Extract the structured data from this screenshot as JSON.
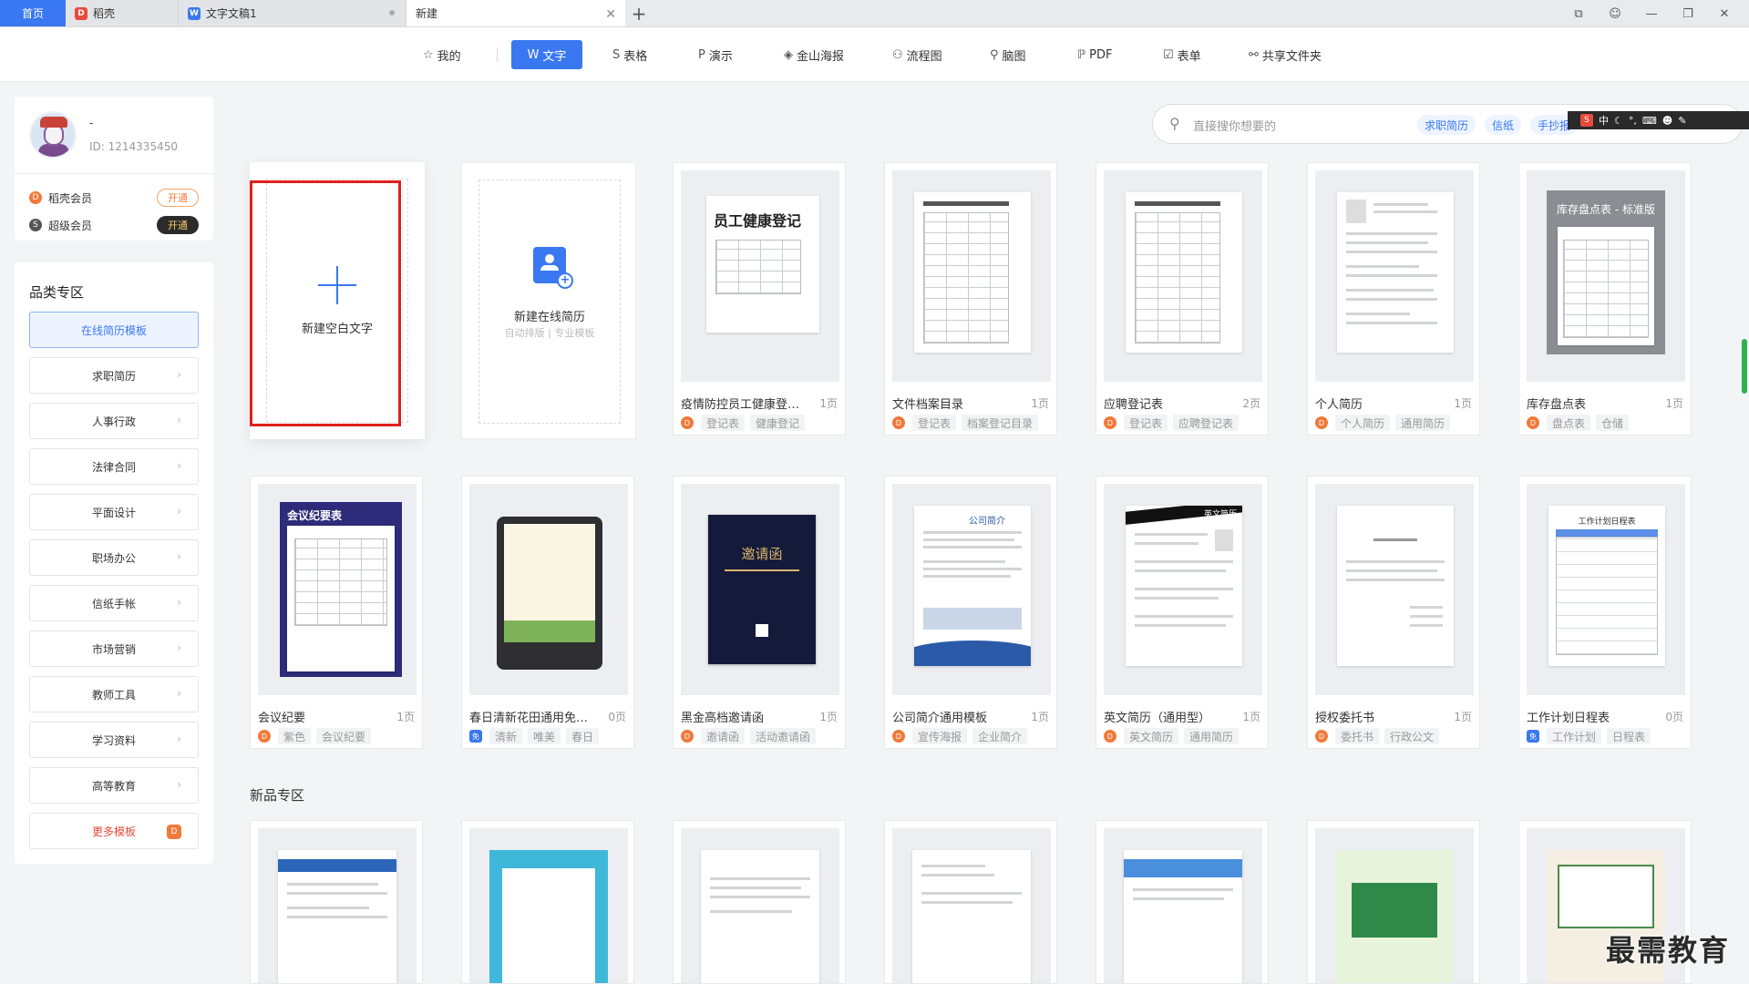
{
  "tabs": [
    {
      "label": "首页"
    },
    {
      "label": "稻壳"
    },
    {
      "label": "文字文稿1"
    },
    {
      "label": "新建"
    }
  ],
  "nav": {
    "items": [
      {
        "label": "我的",
        "icon": "star-icon"
      },
      {
        "label": "文字",
        "icon": "w-icon",
        "active": true
      },
      {
        "label": "表格",
        "icon": "s-icon"
      },
      {
        "label": "演示",
        "icon": "p-icon"
      },
      {
        "label": "金山海报",
        "icon": "poster-icon"
      },
      {
        "label": "流程图",
        "icon": "flowchart-icon"
      },
      {
        "label": "脑图",
        "icon": "mindmap-icon"
      },
      {
        "label": "PDF",
        "icon": "pdf-icon"
      },
      {
        "label": "表单",
        "icon": "form-icon"
      },
      {
        "label": "共享文件夹",
        "icon": "share-folder-icon"
      }
    ]
  },
  "user": {
    "name": "-",
    "id": "ID: 1214335450",
    "memberships": [
      {
        "label": "稻壳会员",
        "button": "开通"
      },
      {
        "label": "超级会员",
        "button": "开通"
      }
    ]
  },
  "sidebar": {
    "title": "品类专区",
    "items": [
      {
        "label": "在线简历模板"
      },
      {
        "label": "求职简历"
      },
      {
        "label": "人事行政"
      },
      {
        "label": "法律合同"
      },
      {
        "label": "平面设计"
      },
      {
        "label": "职场办公"
      },
      {
        "label": "信纸手帐"
      },
      {
        "label": "市场营销"
      },
      {
        "label": "教师工具"
      },
      {
        "label": "学习资料"
      },
      {
        "label": "高等教育"
      },
      {
        "label": "更多模板"
      }
    ]
  },
  "search": {
    "placeholder": "直接搜你想要的",
    "tags": [
      "求职简历",
      "信纸",
      "手抄报"
    ]
  },
  "ime": {
    "label": "中"
  },
  "create": {
    "blank_label": "新建空白文字",
    "resume_label": "新建在线简历",
    "resume_sub": "自动排版 | 专业模板"
  },
  "templates": [
    {
      "title": "疫情防控员工健康登记...",
      "pages": "1页",
      "tags": [
        "登记表",
        "健康登记"
      ],
      "thumb_heading": "员工健康登记"
    },
    {
      "title": "文件档案目录",
      "pages": "1页",
      "tags": [
        "登记表",
        "档案登记目录"
      ]
    },
    {
      "title": "应聘登记表",
      "pages": "2页",
      "tags": [
        "登记表",
        "应聘登记表"
      ]
    },
    {
      "title": "个人简历",
      "pages": "1页",
      "tags": [
        "个人简历",
        "通用简历"
      ]
    },
    {
      "title": "库存盘点表",
      "pages": "1页",
      "tags": [
        "盘点表",
        "仓储"
      ],
      "thumb_heading": "库存盘点表 - 标准版"
    },
    {
      "title": "会议纪要",
      "pages": "1页",
      "tags": [
        "紫色",
        "会议纪要"
      ],
      "thumb_heading": "会议纪要表"
    },
    {
      "title": "春日清新花田通用免费...",
      "pages": "0页",
      "tags": [
        "清新",
        "唯美",
        "春日"
      ]
    },
    {
      "title": "黑金高档邀请函",
      "pages": "1页",
      "tags": [
        "邀请函",
        "活动邀请函"
      ],
      "thumb_heading": "邀请函"
    },
    {
      "title": "公司简介通用模板",
      "pages": "1页",
      "tags": [
        "宣传海报",
        "企业简介"
      ],
      "thumb_heading": "公司简介"
    },
    {
      "title": "英文简历（通用型）",
      "pages": "1页",
      "tags": [
        "英文简历",
        "通用简历"
      ],
      "thumb_heading": "英文简历"
    },
    {
      "title": "授权委托书",
      "pages": "1页",
      "tags": [
        "委托书",
        "行政公文"
      ]
    },
    {
      "title": "工作计划日程表",
      "pages": "0页",
      "tags": [
        "工作计划",
        "日程表"
      ],
      "thumb_heading": "工作计划日程表"
    }
  ],
  "new_section": {
    "title": "新品专区"
  },
  "watermark": "最需教育"
}
